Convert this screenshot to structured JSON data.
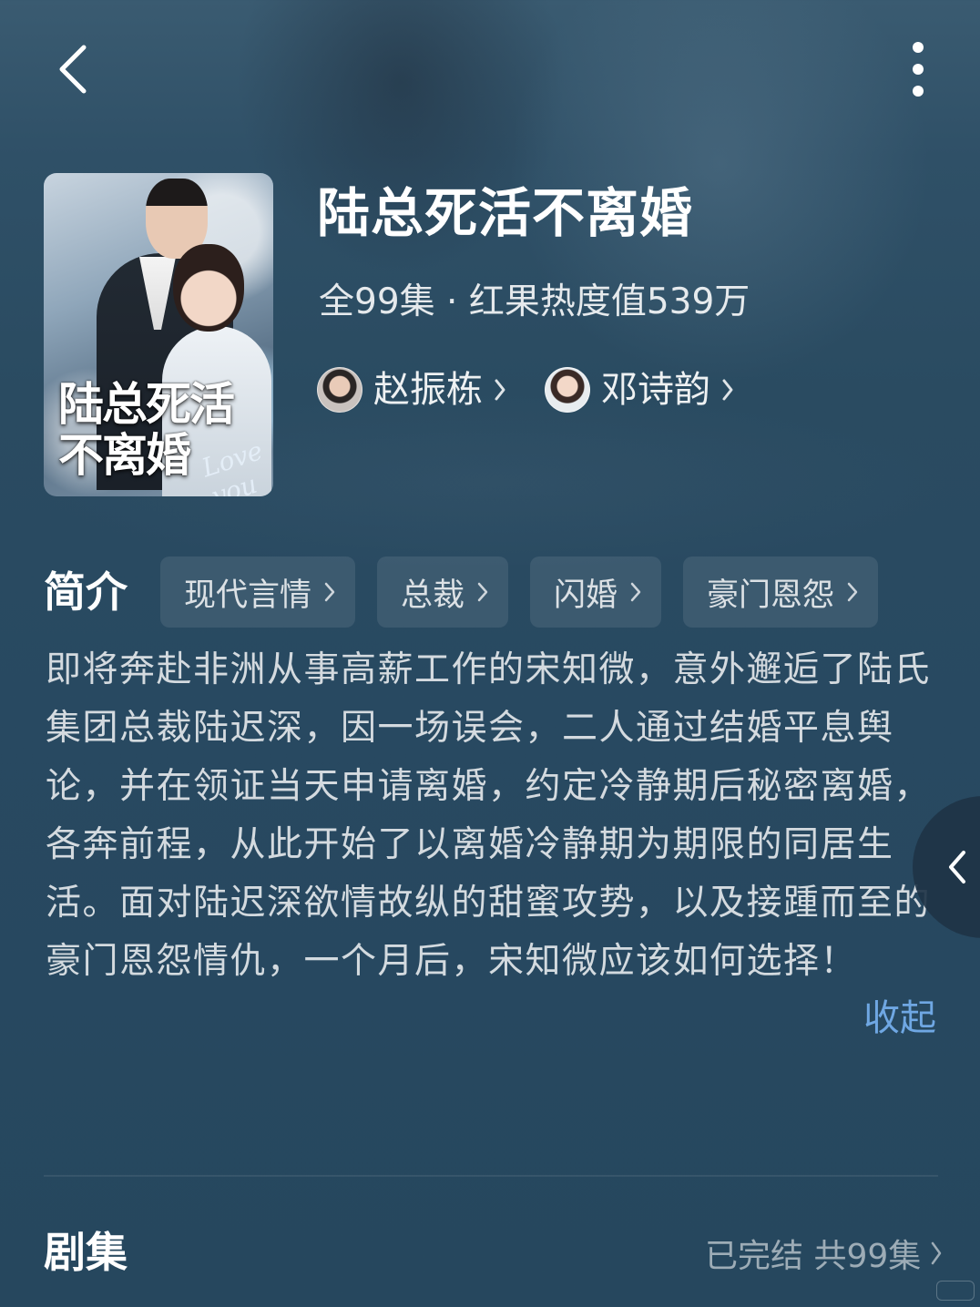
{
  "header": {
    "back_icon": "back-arrow-icon",
    "more_icon": "more-vertical-icon"
  },
  "drama": {
    "title": "陆总死活不离婚",
    "poster_title": "陆总死活\n不离婚",
    "poster_script": "Love you",
    "meta": "全99集 · 红果热度值539万",
    "actors": [
      {
        "name": "赵振栋"
      },
      {
        "name": "邓诗韵"
      }
    ]
  },
  "intro": {
    "label": "简介",
    "tags": [
      "现代言情",
      "总裁",
      "闪婚",
      "豪门恩怨"
    ],
    "synopsis": "即将奔赴非洲从事高薪工作的宋知微，意外邂逅了陆氏集团总裁陆迟深，因一场误会，二人通过结婚平息舆论，并在领证当天申请离婚，约定冷静期后秘密离婚，各奔前程，从此开始了以离婚冷静期为期限的同居生活。面对陆迟深欲情故纵的甜蜜攻势，以及接踵而至的豪门恩怨情仇，一个月后，宋知微应该如何选择！",
    "collapse_label": "收起"
  },
  "episodes": {
    "label": "剧集",
    "status": "已完结 共99集"
  },
  "colors": {
    "background": "#2a4b61",
    "accent_link": "#6fa7e3"
  }
}
